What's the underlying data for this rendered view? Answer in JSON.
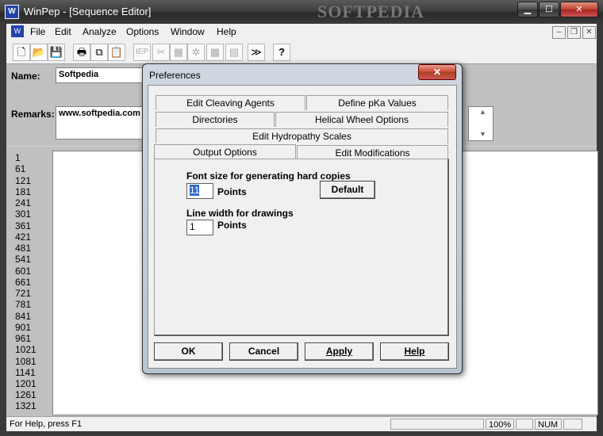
{
  "window": {
    "title": "WinPep - [Sequence Editor]",
    "watermark": "SOFTPEDIA",
    "min_glyph": "▁",
    "max_glyph": "☐",
    "close_glyph": "✕"
  },
  "menubar": {
    "items": [
      "File",
      "Edit",
      "Analyze",
      "Options",
      "Window",
      "Help"
    ],
    "mdi_min": "–",
    "mdi_restore": "❐",
    "mdi_close": "✕"
  },
  "toolbar": {
    "buttons": [
      {
        "name": "new-icon",
        "glyph": "🗋"
      },
      {
        "name": "open-icon",
        "glyph": "📂"
      },
      {
        "name": "save-icon",
        "glyph": "💾"
      },
      {
        "name": "print-icon",
        "glyph": "🖶"
      },
      {
        "name": "copy-icon",
        "glyph": "⧉"
      },
      {
        "name": "paste-icon",
        "glyph": "📋"
      },
      {
        "name": "iep-icon",
        "glyph": "IEP"
      },
      {
        "name": "cut-icon",
        "glyph": "✂"
      },
      {
        "name": "chart-icon",
        "glyph": "▦"
      },
      {
        "name": "wheel-icon",
        "glyph": "✲"
      },
      {
        "name": "plot-icon",
        "glyph": "▦"
      },
      {
        "name": "hydropathy-icon",
        "glyph": "▤"
      },
      {
        "name": "next-icon",
        "glyph": "≫"
      },
      {
        "name": "help-icon",
        "glyph": "?"
      }
    ]
  },
  "form": {
    "name_label": "Name:",
    "name_value": "Softpedia",
    "remarks_label": "Remarks:",
    "remarks_value": "www.softpedia.com"
  },
  "sequence": {
    "line_numbers": [
      "1",
      "61",
      "121",
      "181",
      "241",
      "301",
      "361",
      "421",
      "481",
      "541",
      "601",
      "661",
      "721",
      "781",
      "841",
      "901",
      "961",
      "1021",
      "1081",
      "1141",
      "1201",
      "1261",
      "1321"
    ]
  },
  "statusbar": {
    "help_text": "For Help, press F1",
    "zoom": "100%",
    "num": "NUM"
  },
  "dialog": {
    "title": "Preferences",
    "close_glyph": "✕",
    "tabs_row1": [
      "Edit Cleaving Agents",
      "Define pKa Values"
    ],
    "tabs_row2": [
      "Directories",
      "Helical Wheel Options"
    ],
    "tabs_row3": [
      "Edit Hydropathy Scales"
    ],
    "tabs_row4": [
      "Output Options",
      "Edit Modifications"
    ],
    "font_size_label": "Font size for generating hard copies",
    "font_size_value": "11",
    "font_size_unit": "Points",
    "default_button": "Default",
    "line_width_label": "Line width for drawings",
    "line_width_value": "1",
    "line_width_unit": "Points",
    "ok_button": "OK",
    "cancel_button": "Cancel",
    "apply_button": "Apply",
    "help_button": "Help"
  }
}
